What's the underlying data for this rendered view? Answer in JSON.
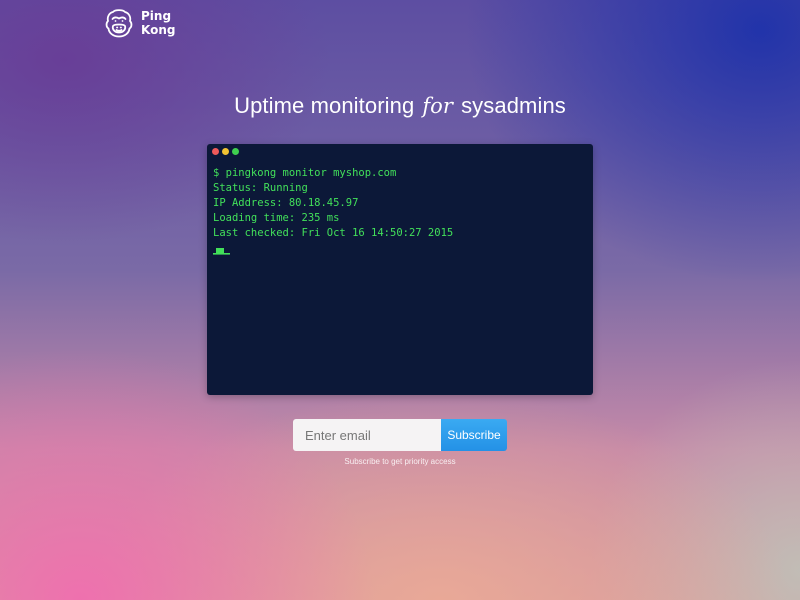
{
  "brand": {
    "name_line1": "Ping",
    "name_line2": "Kong",
    "icon": "gorilla-icon"
  },
  "hero": {
    "headline_before": "Uptime monitoring",
    "headline_for": "for",
    "headline_after": "sysadmins"
  },
  "terminal": {
    "window_dots": [
      "red",
      "yellow",
      "green"
    ],
    "lines": [
      "$ pingkong monitor myshop.com",
      "Status: Running",
      "IP Address: 80.18.45.97",
      "Loading time: 235 ms",
      "Last checked: Fri Oct 16 14:50:27 2015"
    ],
    "text_color": "#42e05a",
    "background_color": "#0c1838"
  },
  "subscribe": {
    "email_placeholder": "Enter email",
    "email_value": "",
    "button_label": "Subscribe",
    "caption": "Subscribe to get priority access"
  },
  "colors": {
    "accent": "#2a9bec",
    "dot_red": "#ee5a5a",
    "dot_yellow": "#f1c232",
    "dot_green": "#3fcf4f"
  }
}
